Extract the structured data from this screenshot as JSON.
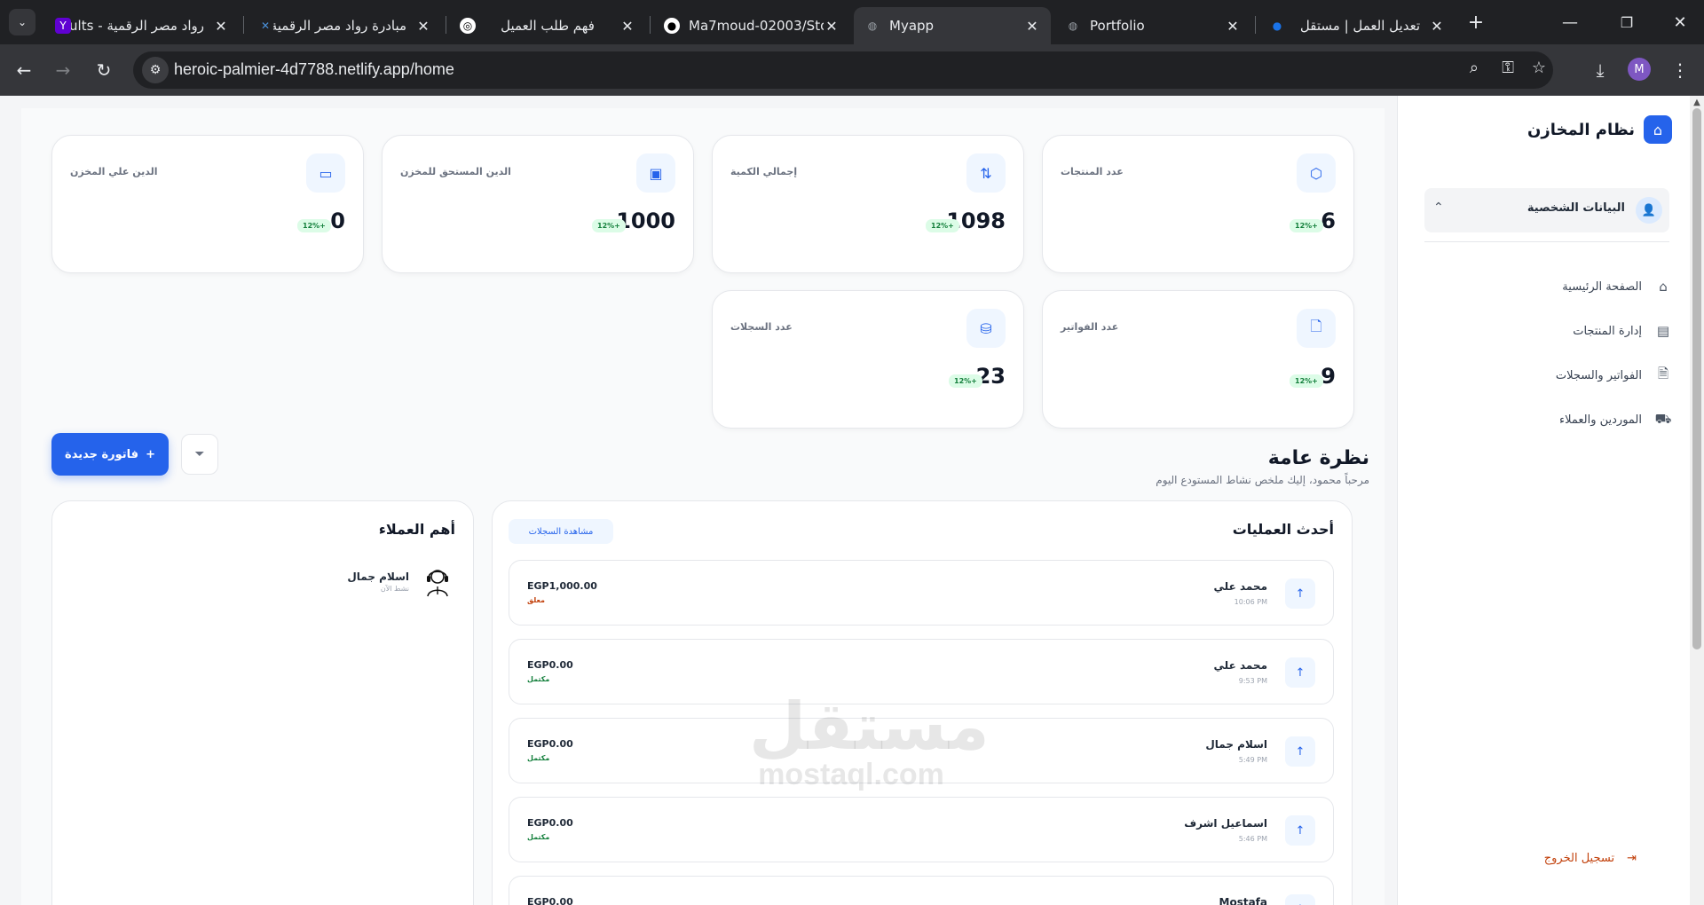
{
  "browser": {
    "tabs": [
      {
        "title": "رواد مصر الرقمية - ults",
        "favicon": "Y",
        "favicon_color": "#6001d2"
      },
      {
        "title": "مبادرة رواد مصر الرقمية",
        "favicon": "✕",
        "favicon_color": "#202124"
      },
      {
        "title": "فهم طلب العميل",
        "favicon": "◎",
        "favicon_color": "#202124"
      },
      {
        "title": "Ma7moud-02003/Sto",
        "favicon": "●",
        "favicon_color": "#202124"
      },
      {
        "title": "Myapp",
        "favicon": "◍",
        "favicon_color": "#35363a"
      },
      {
        "title": "Portfolio",
        "favicon": "◍",
        "favicon_color": "#202124"
      },
      {
        "title": "تعديل العمل | مستقل",
        "favicon": "●",
        "favicon_color": "#1a73e8"
      }
    ],
    "url": "heroic-palmier-4d7788.netlify.app/home",
    "avatar_letter": "M"
  },
  "sidebar": {
    "brand": "نظام المخازن",
    "profile_label": "البيانات الشخصية",
    "items": [
      {
        "label": "الصفحة الرئيسية",
        "icon": "home-icon"
      },
      {
        "label": "إدارة المنتجات",
        "icon": "boxes-icon"
      },
      {
        "label": "الفواتير والسجلات",
        "icon": "invoice-icon"
      },
      {
        "label": "الموردين والعملاء",
        "icon": "truck-icon"
      }
    ],
    "logout": "تسجيل الخروج"
  },
  "stats": [
    {
      "label": "عدد المنتجات",
      "value": "6",
      "badge": "12%+",
      "icon": "box-icon"
    },
    {
      "label": "إجمالي الكمية",
      "value": "1098",
      "badge": "12%+",
      "icon": "arrows-icon"
    },
    {
      "label": "الدين المستحق للمخزن",
      "value": "1000",
      "badge": "12%+",
      "icon": "wallet-icon"
    },
    {
      "label": "الدين علي المخزن",
      "value": "0",
      "badge": "12%+",
      "icon": "card-icon"
    },
    {
      "label": "عدد الفواتير",
      "value": "9",
      "badge": "12%+",
      "icon": "file-icon"
    },
    {
      "label": "عدد السجلات",
      "value": "23",
      "badge": "12%+",
      "icon": "database-icon"
    }
  ],
  "overview": {
    "title": "نظرة عامة",
    "subtitle": "مرحباً محمود، إليك ملخص نشاط المستودع اليوم",
    "new_invoice": "فاتورة جديدة",
    "new_invoice_icon": "+"
  },
  "operations": {
    "title": "أحدث العمليات",
    "view_logs": "مشاهدة السجلات",
    "rows": [
      {
        "name": "محمد علي",
        "time": "10:06 PM",
        "amount": "EGP1,000.00",
        "status": "معلق",
        "status_color": "#c2410c"
      },
      {
        "name": "محمد علي",
        "time": "9:53 PM",
        "amount": "EGP0.00",
        "status": "مكتمل",
        "status_color": "#15803d"
      },
      {
        "name": "اسلام جمال",
        "time": "5:49 PM",
        "amount": "EGP0.00",
        "status": "مكتمل",
        "status_color": "#15803d"
      },
      {
        "name": "اسماعيل اشرف",
        "time": "5:46 PM",
        "amount": "EGP0.00",
        "status": "مكتمل",
        "status_color": "#15803d"
      },
      {
        "name": "Mostafa",
        "time": "",
        "amount": "EGP0.00",
        "status": "",
        "status_color": "#15803d"
      }
    ]
  },
  "customers": {
    "title": "أهم العملاء",
    "items": [
      {
        "name": "اسلام جمال",
        "status": "نشط الآن"
      }
    ]
  },
  "watermark": {
    "ar": "مستقل",
    "en": "mostaql.com"
  }
}
